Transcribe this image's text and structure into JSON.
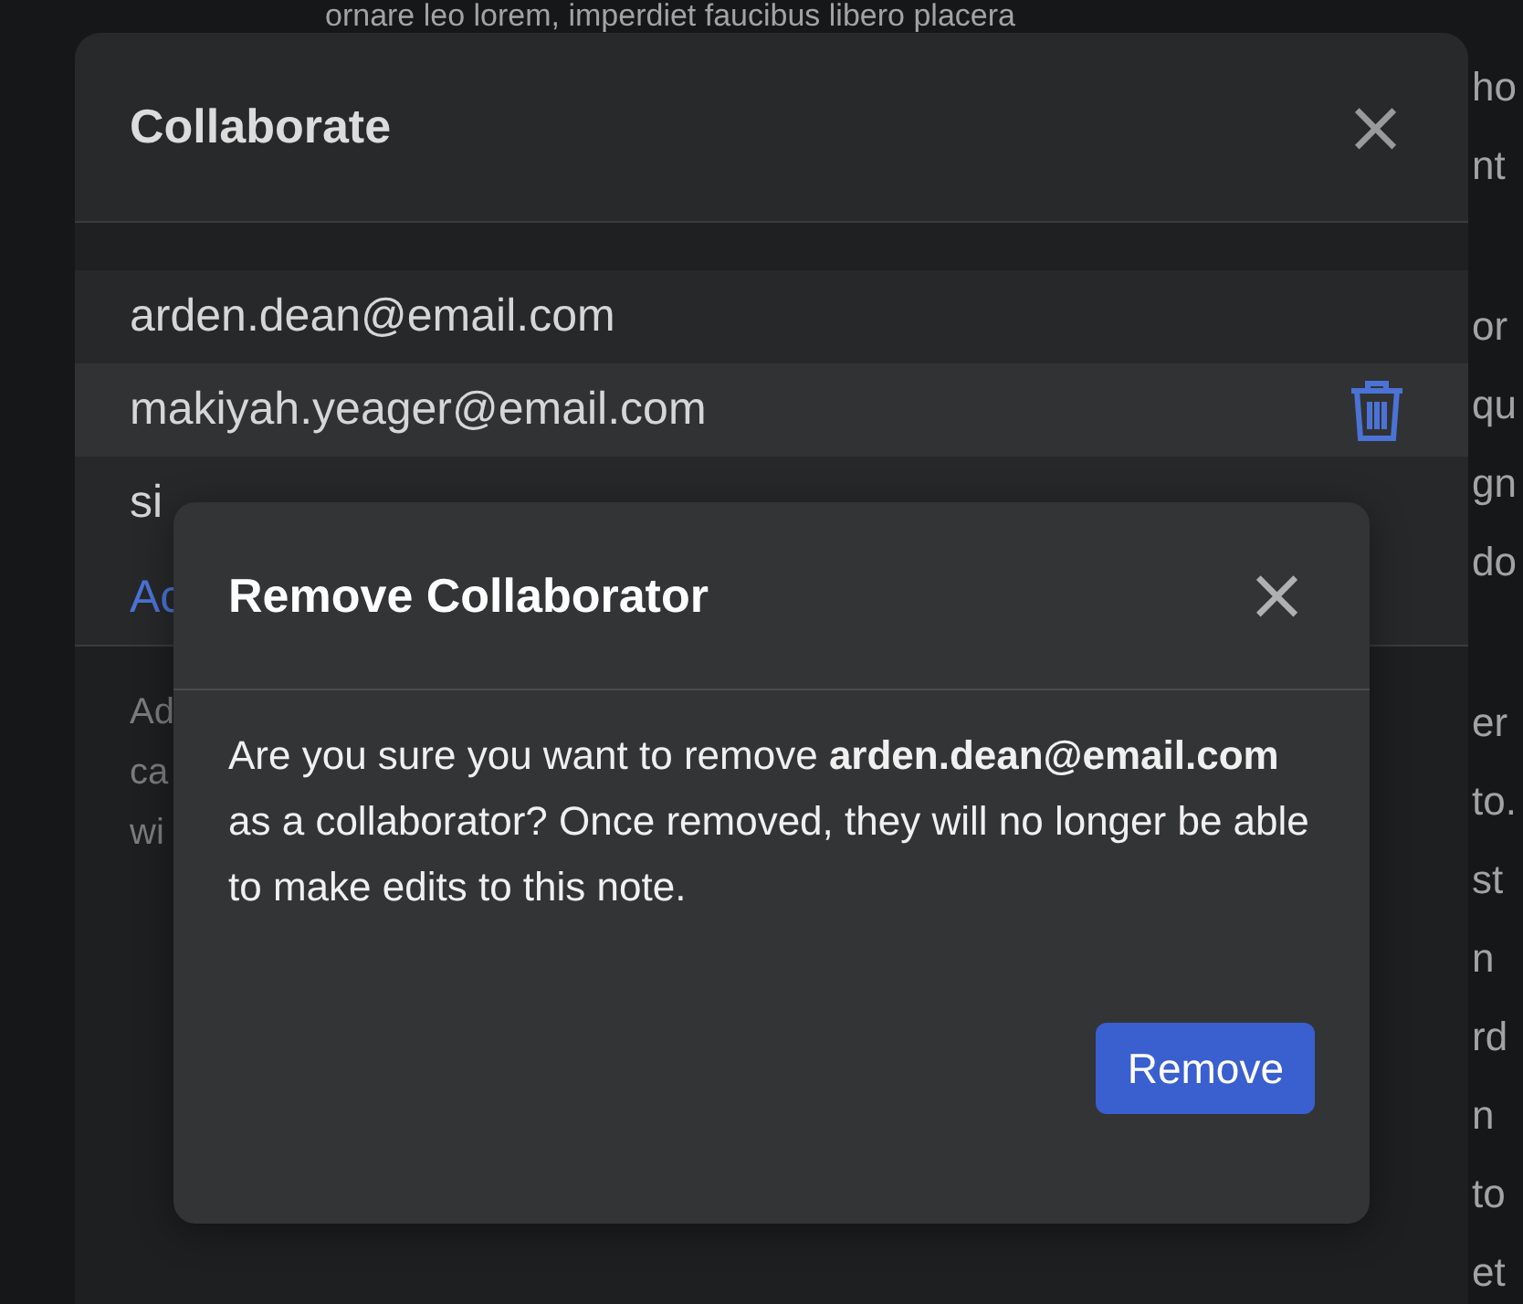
{
  "note": {
    "paragraphs": [
      [
        "ornare leo lorem, imperdiet faucibus libero placera",
        "ho",
        "nt"
      ],
      [
        "or",
        "qu",
        "gn",
        "do"
      ],
      [
        "er",
        "to.",
        "st",
        "n",
        "rd",
        "n",
        "to",
        "et"
      ]
    ]
  },
  "collaborate_dialog": {
    "title": "Collaborate",
    "close_icon": "×",
    "collaborators": [
      {
        "email": "arden.dean@email.com",
        "selected": false
      },
      {
        "email": "makiyah.yeager@email.com",
        "selected": true
      },
      {
        "email": "si",
        "selected": false
      }
    ],
    "add_link": "Ac",
    "description_lines": [
      "Ad",
      "ca",
      "wi"
    ]
  },
  "remove_dialog": {
    "title": "Remove Collaborator",
    "close_icon": "×",
    "message": "Are you sure you want to remove **arden.dean@email.com** as a collaborator? Once removed, they will no longer be able to make edits to this note.",
    "button": "Remove"
  }
}
